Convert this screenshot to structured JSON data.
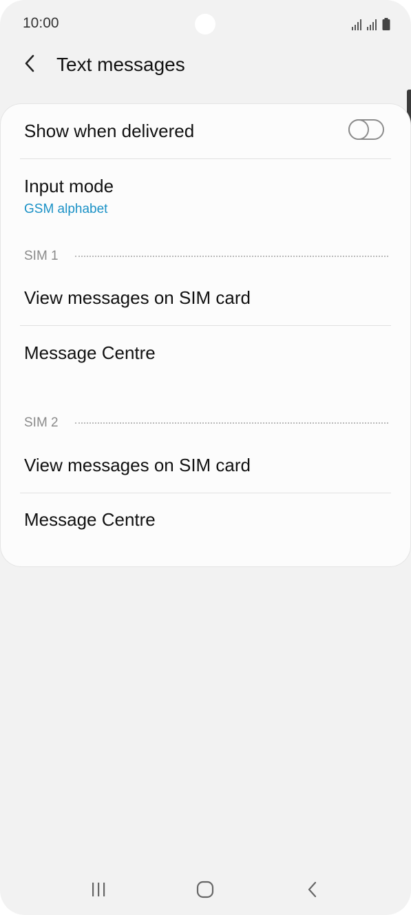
{
  "status_bar": {
    "time": "10:00",
    "icons": [
      "signal-sim1-icon",
      "signal-sim2-icon",
      "battery-icon"
    ]
  },
  "header": {
    "title": "Text messages",
    "back_icon": "chevron-left-icon"
  },
  "settings": {
    "show_when_delivered": {
      "label": "Show when delivered",
      "toggle_on": false
    },
    "input_mode": {
      "label": "Input mode",
      "value": "GSM alphabet"
    },
    "sim1": {
      "header": "SIM 1",
      "view_messages": "View messages on SIM card",
      "message_centre": "Message Centre"
    },
    "sim2": {
      "header": "SIM 2",
      "view_messages": "View messages on SIM card",
      "message_centre": "Message Centre"
    }
  },
  "nav_bar": {
    "icons": [
      "recent-apps-icon",
      "home-icon",
      "back-icon"
    ]
  },
  "colors": {
    "background": "#f2f2f2",
    "card": "#fcfcfc",
    "accent": "#1a91c6",
    "section_label": "#8a8a8a"
  }
}
